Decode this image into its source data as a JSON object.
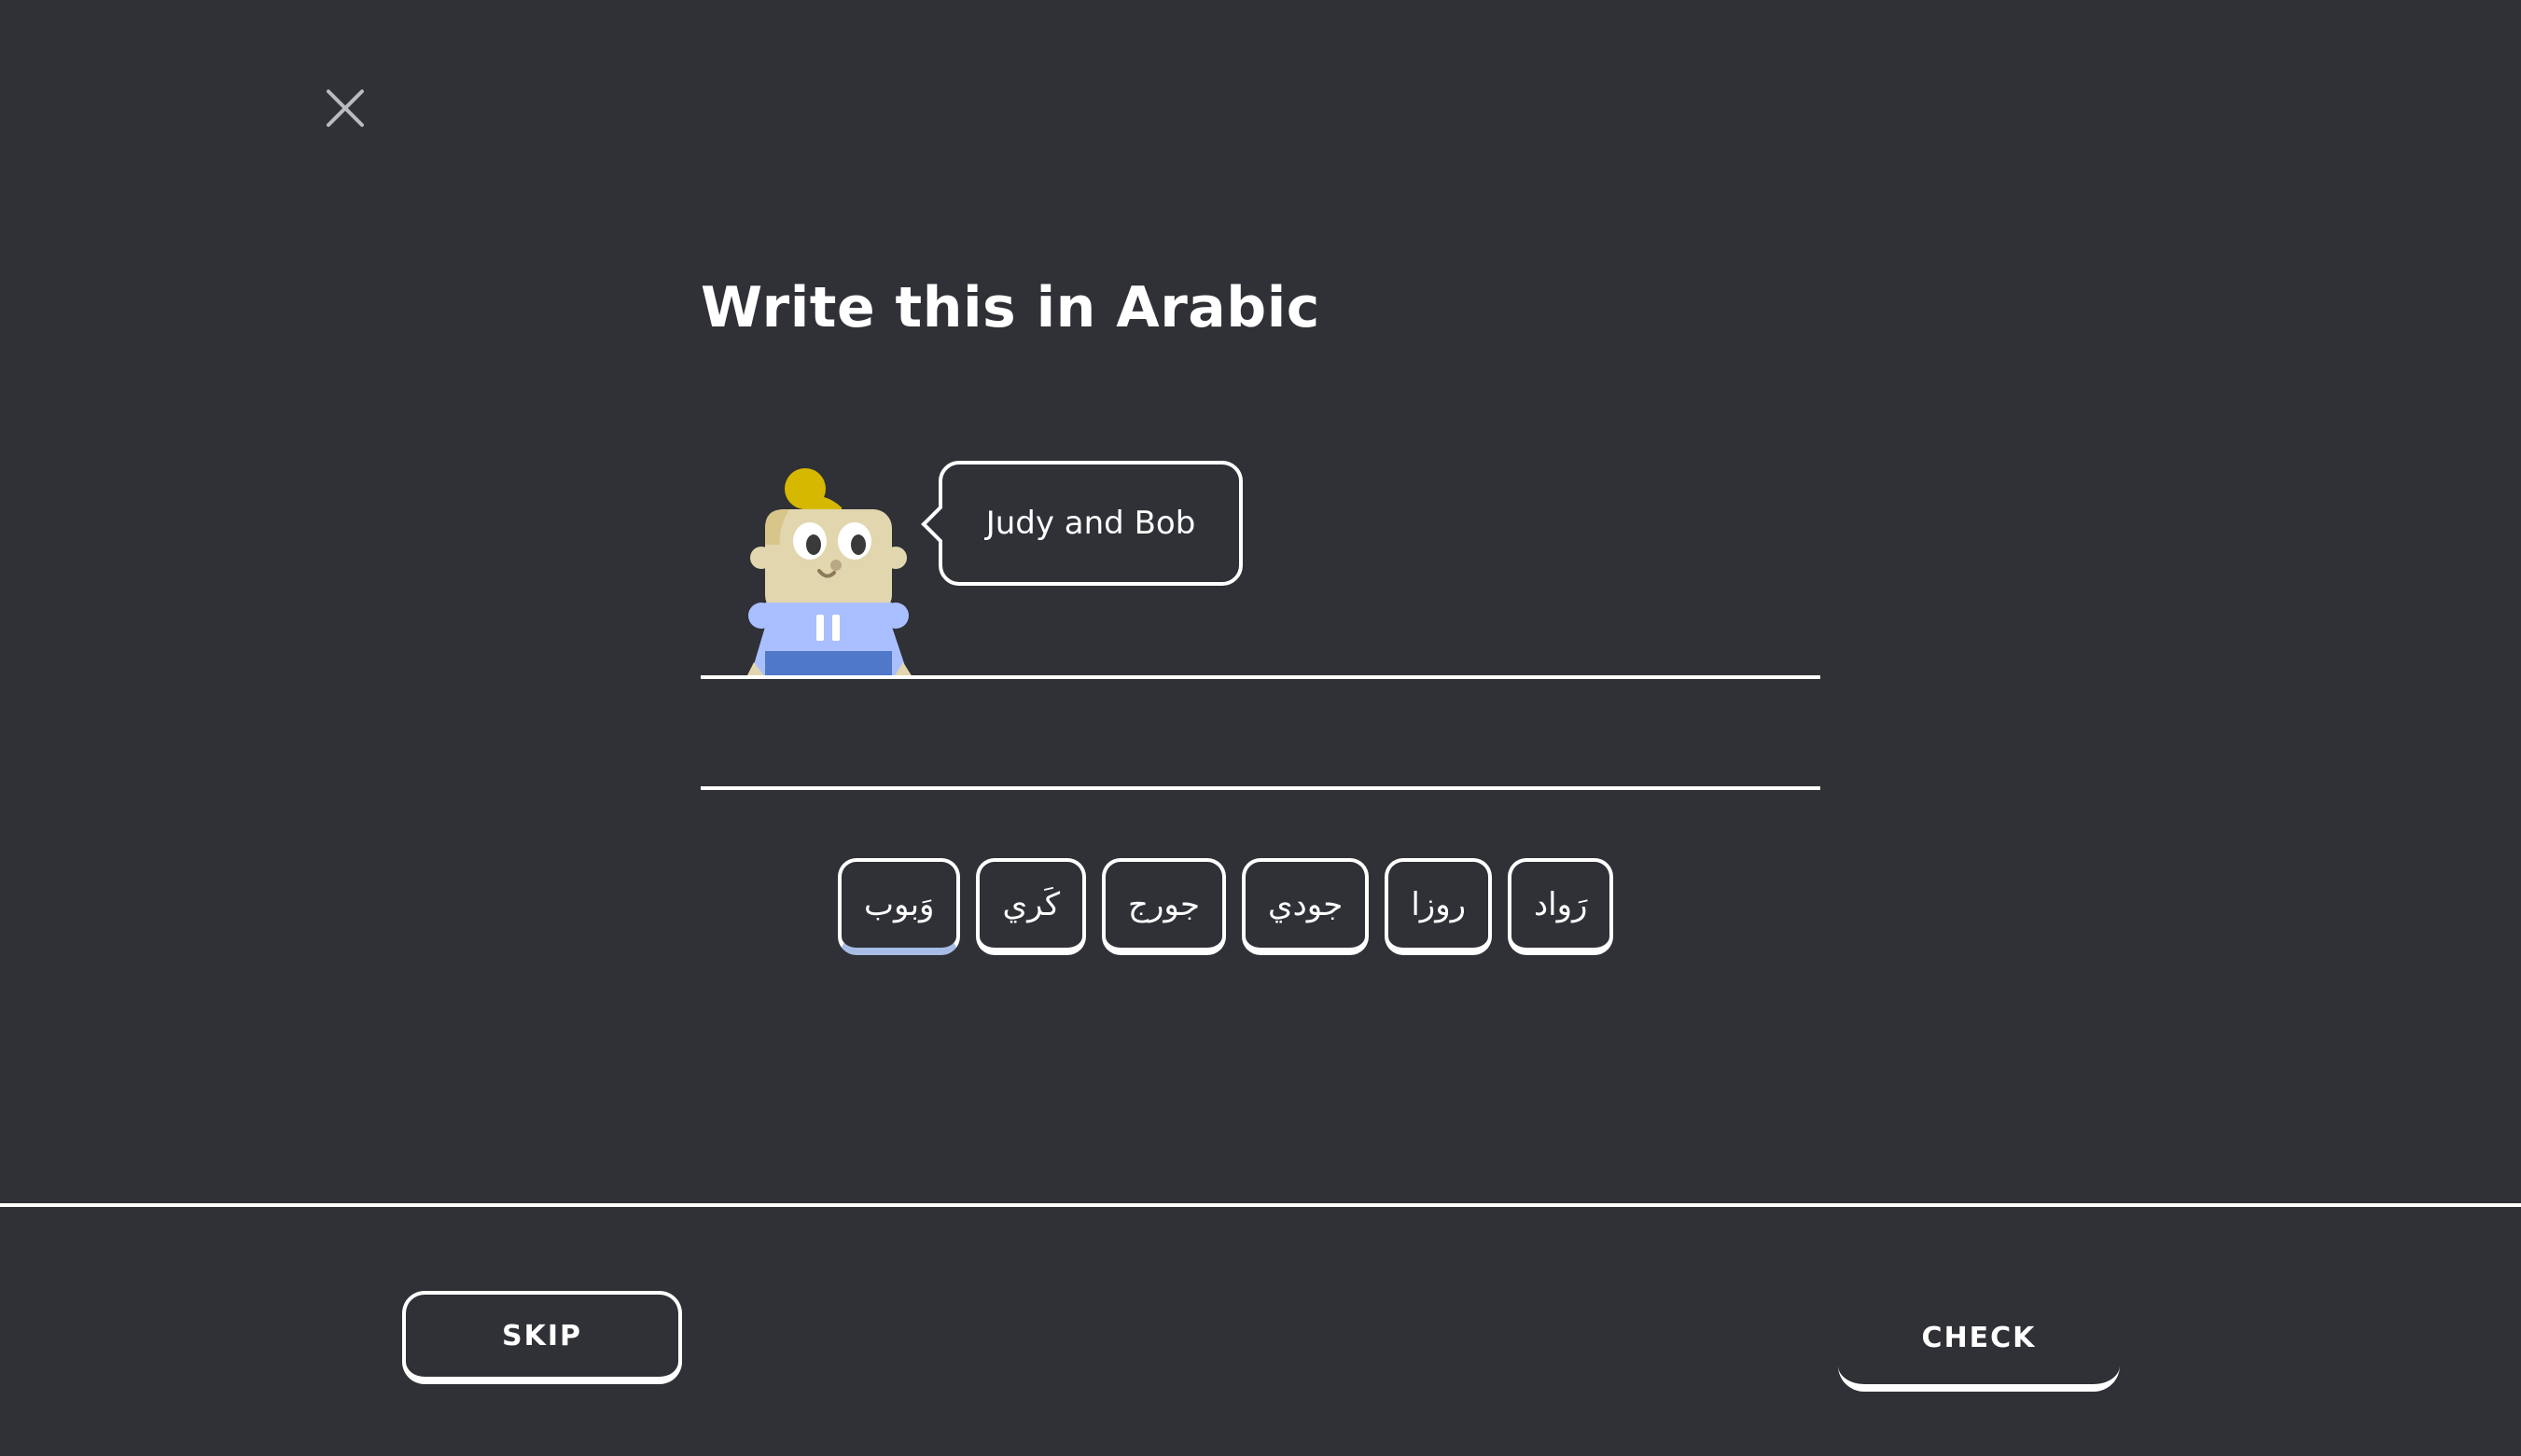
{
  "lesson": {
    "title": "Write this in Arabic",
    "prompt": "Judy and Bob"
  },
  "word_bank": [
    "وَبوب",
    "كَري",
    "جورج",
    "جودي",
    "روزا",
    "رَواد"
  ],
  "footer": {
    "skip_label": "SKIP",
    "check_label": "CHECK"
  },
  "icons": {
    "close": "close-x-icon",
    "character": "character-avatar"
  },
  "colors": {
    "background": "#2f3136",
    "foreground": "#ffffff",
    "tile_accent": "#a8bde6",
    "character_hair": "#d6b800",
    "character_skin": "#e2d6ae",
    "character_shirt": "#aabfff",
    "character_pants": "#4f79c8"
  }
}
